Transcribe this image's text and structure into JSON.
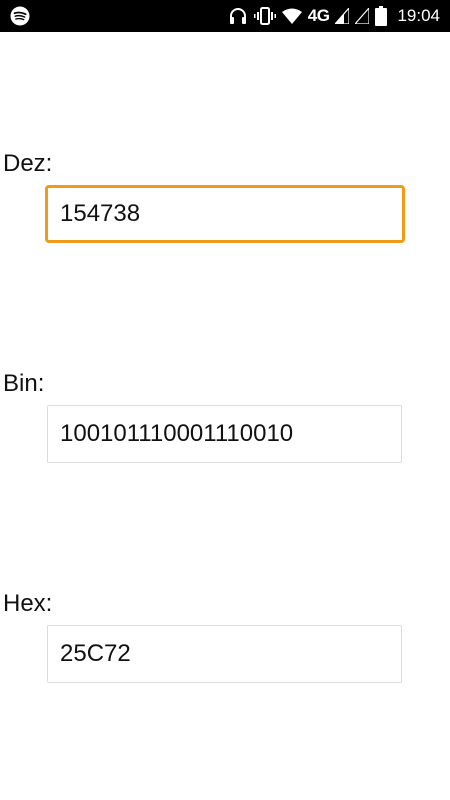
{
  "status_bar": {
    "network": "4G",
    "time": "19:04",
    "icons": [
      "spotify-icon",
      "headphones-icon",
      "vibrate-icon",
      "wifi-icon",
      "signal-icon",
      "signal-icon",
      "battery-icon"
    ]
  },
  "fields": [
    {
      "label": "Dez:",
      "value": "154738",
      "focused": true
    },
    {
      "label": "Bin:",
      "value": "100101110001110010",
      "focused": false
    },
    {
      "label": "Hex:",
      "value": "25C72",
      "focused": false
    }
  ],
  "colors": {
    "focus_border": "#f09a1a",
    "status_bar_bg": "#000000"
  }
}
